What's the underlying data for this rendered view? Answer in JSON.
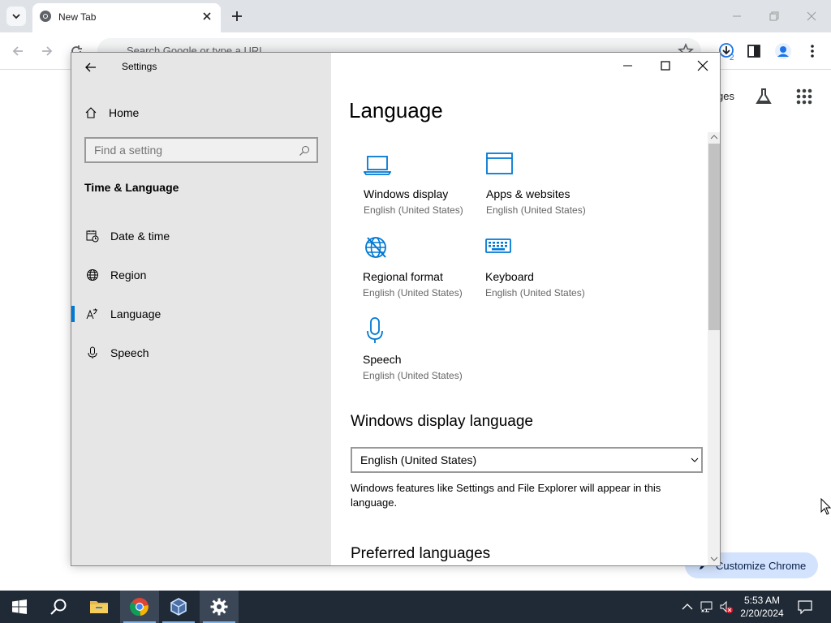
{
  "browser": {
    "tab_title": "New Tab",
    "omnibox_placeholder": "Search Google or type a URL",
    "download_badge": "2",
    "ntp_link_partial": "ges",
    "customize_label": "Customize Chrome"
  },
  "settings_window": {
    "title": "Settings",
    "home_label": "Home",
    "search_placeholder": "Find a setting",
    "section_heading": "Time & Language",
    "nav_items": [
      {
        "label": "Date & time",
        "icon": "calendar-clock-icon"
      },
      {
        "label": "Region",
        "icon": "globe-icon"
      },
      {
        "label": "Language",
        "icon": "language-icon",
        "active": true
      },
      {
        "label": "Speech",
        "icon": "microphone-icon"
      }
    ],
    "page_title": "Language",
    "tiles": [
      {
        "title": "Windows display",
        "sub": "English (United States)",
        "icon": "laptop-icon"
      },
      {
        "title": "Apps & websites",
        "sub": "English (United States)",
        "icon": "window-icon"
      },
      {
        "title": "Regional format",
        "sub": "English (United States)",
        "icon": "globe-format-icon"
      },
      {
        "title": "Keyboard",
        "sub": "English (United States)",
        "icon": "keyboard-icon"
      },
      {
        "title": "Speech",
        "sub": "English (United States)",
        "icon": "microphone-icon"
      }
    ],
    "display_language_heading": "Windows display language",
    "display_language_value": "English (United States)",
    "display_language_desc": "Windows features like Settings and File Explorer will appear in this language.",
    "preferred_heading": "Preferred languages"
  },
  "taskbar": {
    "time": "5:53 AM",
    "date": "2/20/2024"
  },
  "colors": {
    "accent": "#0078d4",
    "taskbar": "#1f2a36",
    "settings_sidebar": "#e6e6e6"
  }
}
